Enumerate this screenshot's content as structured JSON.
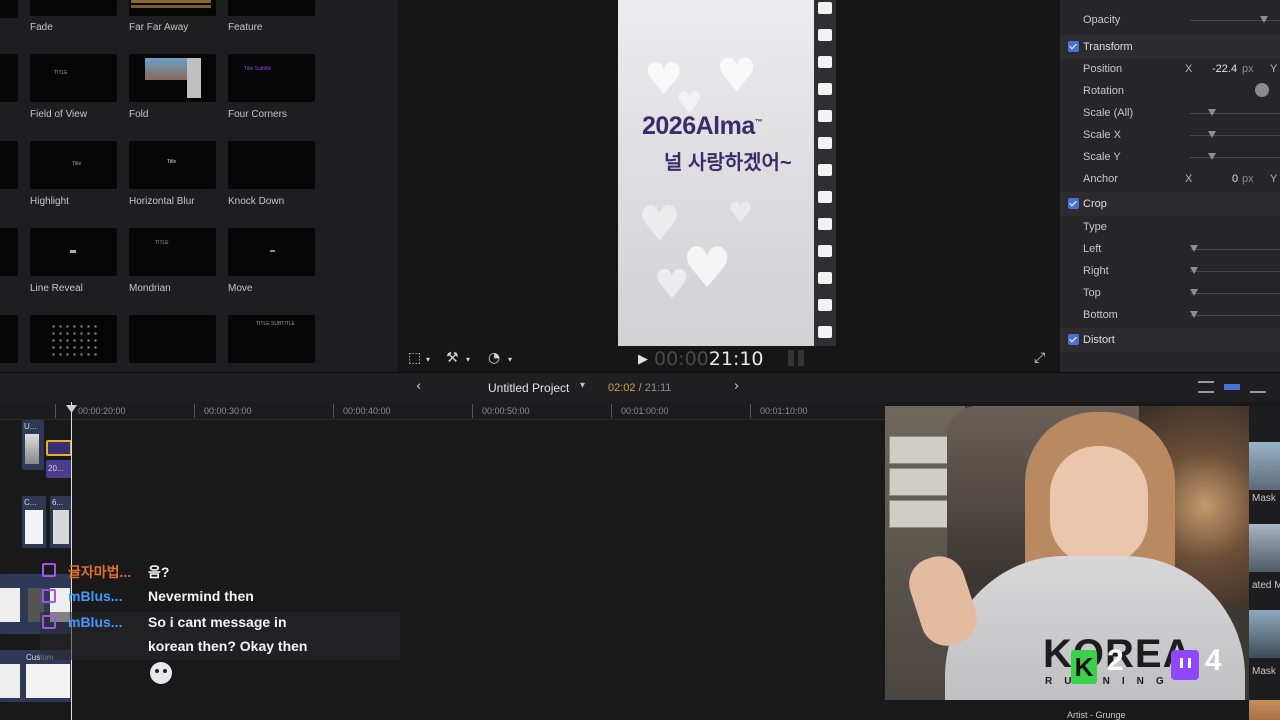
{
  "browser": {
    "tiles": [
      {
        "label": "Fade"
      },
      {
        "label": "Far Far Away"
      },
      {
        "label": "Feature"
      },
      {
        "label": "Field of View"
      },
      {
        "label": "Fold"
      },
      {
        "label": "Four Corners"
      },
      {
        "label": "Highlight"
      },
      {
        "label": "Horizontal Blur"
      },
      {
        "label": "Knock Down"
      },
      {
        "label": "Line Reveal"
      },
      {
        "label": "Mondrian"
      },
      {
        "label": "Move"
      }
    ],
    "mini_text": {
      "field_of_view": "TITLE",
      "four_corners": "Title Subtitle",
      "highlight": "Title",
      "horizontal_blur": "Title",
      "mondrian": "TITLE",
      "last_row_3": "TITLE  SUBTITLE"
    }
  },
  "viewer": {
    "brand_title": "2026Alma",
    "brand_tm": "™",
    "brand_subtitle": "널 사랑하겠어~",
    "timecode_dim": "00:00",
    "timecode": "21:10"
  },
  "inspector": {
    "rows": {
      "opacity": "Opacity",
      "transform": "Transform",
      "position": "Position",
      "position_x_axis": "X",
      "position_x_value": "-22.4",
      "position_unit": "px",
      "position_y_axis": "Y",
      "rotation": "Rotation",
      "scale_all": "Scale (All)",
      "scale_x": "Scale X",
      "scale_y": "Scale Y",
      "anchor": "Anchor",
      "anchor_x_axis": "X",
      "anchor_x_value": "0",
      "anchor_unit": "px",
      "anchor_y_axis": "Y",
      "crop": "Crop",
      "type": "Type",
      "left": "Left",
      "right": "Right",
      "top": "Top",
      "bottom": "Bottom",
      "distort": "Distort"
    }
  },
  "timeline_toolbar": {
    "project_name": "Untitled Project",
    "playhead_time": "02:02",
    "duration": "21:11"
  },
  "ruler": {
    "ticks": [
      "00:00:20:00",
      "00:00:30:00",
      "00:00:40:00",
      "00:00:50:00",
      "00:01:00:00",
      "00:01:10:00"
    ]
  },
  "clips": {
    "c1": "U...",
    "c2": "20...",
    "c3": "C...",
    "c4": "6...",
    "custom": "Custom"
  },
  "chat": [
    {
      "user": "글자마법...",
      "message": "음?",
      "user_color": "#e0702c"
    },
    {
      "user": "mBlus...",
      "message": "Nevermind then",
      "user_color": "#3f9bff"
    },
    {
      "user": "mBlus...",
      "message": "So i cant message in",
      "user_color": "#3f9bff"
    },
    {
      "user": "",
      "message": "korean then? Okay then",
      "user_color": "#3f9bff"
    }
  ],
  "webcam": {
    "logo": "KOREA",
    "logo_sub": "RUNNING",
    "kick_icon": "K",
    "kick_count": "2",
    "twitch_count": "4"
  },
  "effects": {
    "labels": [
      "Mask",
      "ated M",
      "Mask"
    ],
    "artist": "Artist - Grunge"
  },
  "colors": {
    "accent_checkbox": "#4a6fd6",
    "brand_purple": "#3a2c6b",
    "twitch_purple": "#9146ff",
    "kick_green": "#3ad24a",
    "timecode_gold": "#c4a74c"
  }
}
